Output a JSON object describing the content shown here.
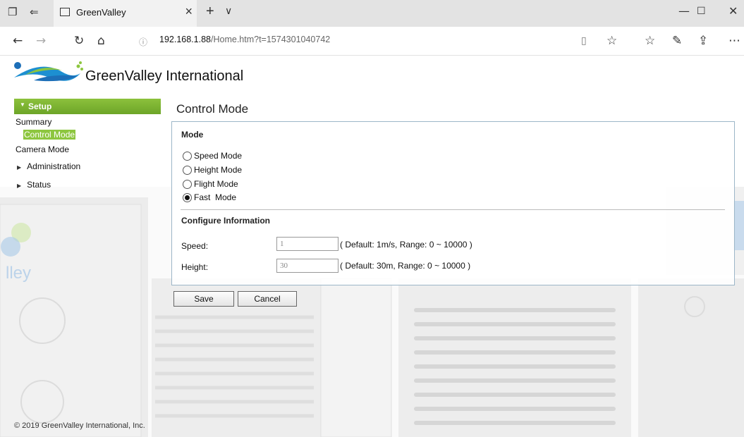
{
  "browser": {
    "tab_title": "GreenValley",
    "url_host": "192.168.1.88",
    "url_path": "/Home.htm?t=1574301040742",
    "icons": [
      "tab-actions-icon",
      "tab-back-icon",
      "page-icon",
      "close-tab-icon",
      "new-tab-icon",
      "tab-list-icon",
      "minimize-icon",
      "maximize-icon",
      "close-window-icon",
      "back-icon",
      "forward-icon",
      "refresh-icon",
      "home-icon",
      "info-icon",
      "reading-view-icon",
      "favorite-icon",
      "favorites-hub-icon",
      "pen-icon",
      "share-icon",
      "more-icon"
    ]
  },
  "brand": {
    "name": "GreenValley International",
    "colors": {
      "green": "#8dc63f",
      "blue": "#1d6fb8"
    }
  },
  "sidebar": {
    "setup_label": "Setup",
    "items": [
      {
        "label": "Summary"
      },
      {
        "label": "Control Mode",
        "selected": true
      },
      {
        "label": "Camera Mode"
      },
      {
        "label": "Administration"
      },
      {
        "label": "Status"
      }
    ]
  },
  "main": {
    "title": "Control Mode",
    "mode_section": "Mode",
    "modes": [
      {
        "label": "Speed Mode",
        "checked": false
      },
      {
        "label": "Height Mode",
        "checked": false
      },
      {
        "label": "Flight Mode",
        "checked": false
      },
      {
        "label": "Fast  Mode",
        "checked": true
      }
    ],
    "config_section": "Configure Information",
    "speed": {
      "label": "Speed:",
      "value": "1",
      "hint": "( Default: 1m/s, Range: 0 ~ 10000 )"
    },
    "height": {
      "label": "Height:",
      "value": "30",
      "hint": "( Default: 30m, Range: 0 ~ 10000 )"
    },
    "save_label": "Save",
    "cancel_label": "Cancel"
  },
  "footer": "© 2019 GreenValley International, Inc."
}
